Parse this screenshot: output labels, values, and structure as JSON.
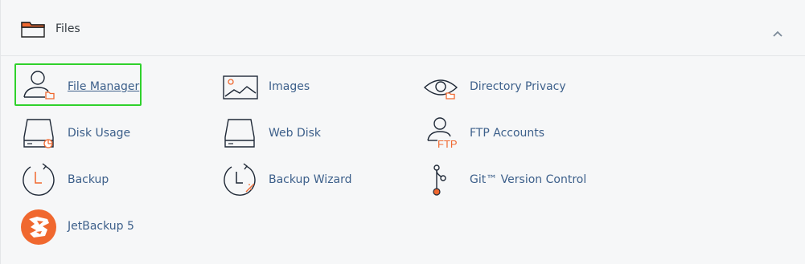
{
  "section": {
    "title": "Files",
    "collapse_icon": "chevron-up-icon",
    "header_icon": "folder-icon"
  },
  "items": [
    {
      "label": "File Manager",
      "icon": "file-manager-icon",
      "selected": true
    },
    {
      "label": "Images",
      "icon": "images-icon"
    },
    {
      "label": "Directory Privacy",
      "icon": "directory-privacy-icon"
    },
    {
      "label": "Disk Usage",
      "icon": "disk-usage-icon"
    },
    {
      "label": "Web Disk",
      "icon": "web-disk-icon"
    },
    {
      "label": "FTP Accounts",
      "icon": "ftp-accounts-icon"
    },
    {
      "label": "Backup",
      "icon": "backup-icon"
    },
    {
      "label": "Backup Wizard",
      "icon": "backup-wizard-icon"
    },
    {
      "label": "Git™ Version Control",
      "icon": "git-version-control-icon"
    },
    {
      "label": "JetBackup 5",
      "icon": "jetbackup-icon"
    }
  ],
  "colors": {
    "accent": "#f0682f",
    "link": "#3c5f8a",
    "icon_stroke": "#1f2937",
    "highlight": "#2fd12c"
  },
  "icon_glyphs": {
    "ftp_badge": "FTP"
  }
}
